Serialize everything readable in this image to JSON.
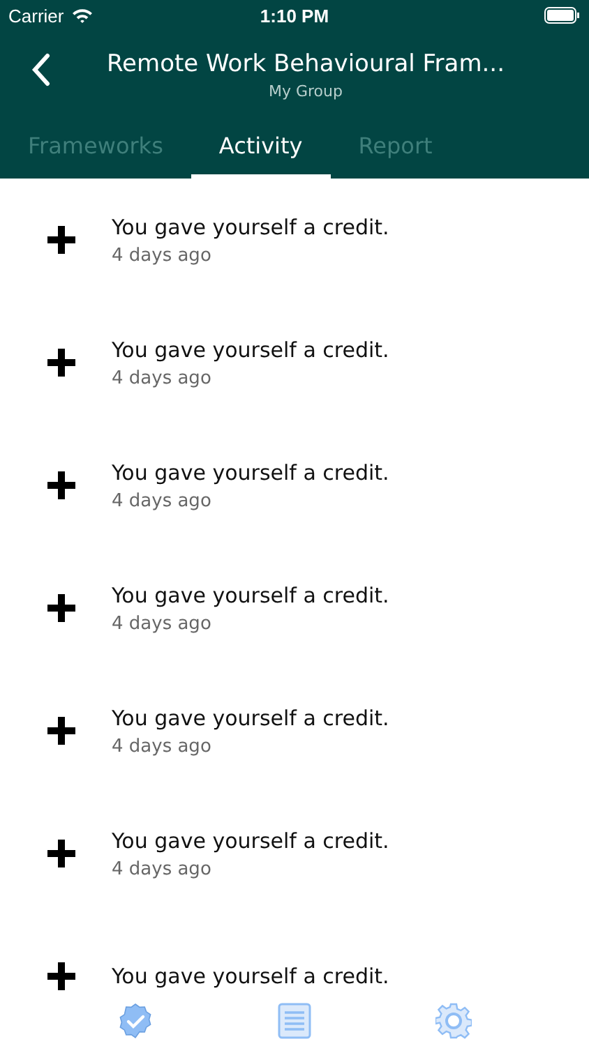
{
  "status_bar": {
    "carrier": "Carrier",
    "time": "1:10 PM"
  },
  "header": {
    "title": "Remote Work Behavioural Fram...",
    "subtitle": "My Group"
  },
  "tabs": [
    {
      "label": "Frameworks",
      "selected": false
    },
    {
      "label": "Activity",
      "selected": true
    },
    {
      "label": "Report",
      "selected": false
    }
  ],
  "activity": [
    {
      "text": "You gave yourself a credit.",
      "time": "4 days ago"
    },
    {
      "text": "You gave yourself a credit.",
      "time": "4 days ago"
    },
    {
      "text": "You gave yourself a credit.",
      "time": "4 days ago"
    },
    {
      "text": "You gave yourself a credit.",
      "time": "4 days ago"
    },
    {
      "text": "You gave yourself a credit.",
      "time": "4 days ago"
    },
    {
      "text": "You gave yourself a credit.",
      "time": "4 days ago"
    },
    {
      "text": "You gave yourself a credit."
    }
  ]
}
